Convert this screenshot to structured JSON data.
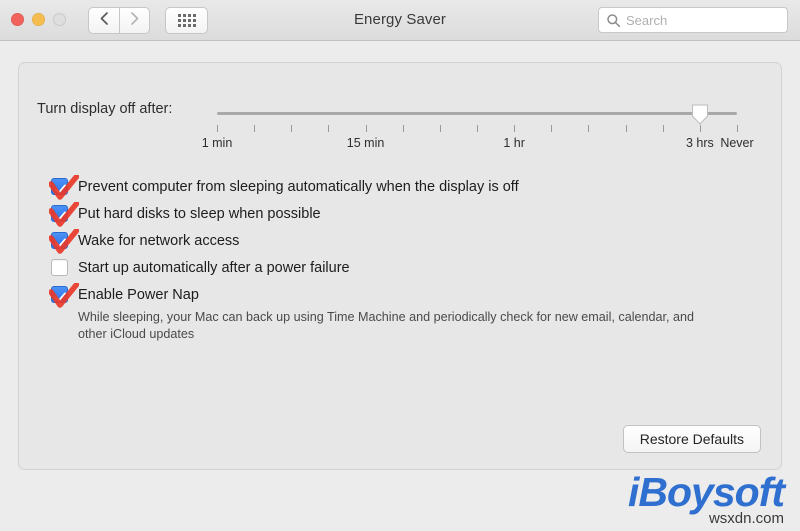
{
  "window": {
    "title": "Energy Saver",
    "traffic_lights": [
      "close",
      "minimize",
      "zoom"
    ]
  },
  "toolbar": {
    "back_icon": "chevron-left-icon",
    "forward_icon": "chevron-right-icon",
    "grid_icon": "show-all-grid-icon",
    "search": {
      "icon": "search-icon",
      "placeholder": "Search",
      "value": ""
    }
  },
  "slider": {
    "label": "Turn display off after:",
    "value_label": "3 hrs",
    "tick_count": 15,
    "thumb_tick_index": 13,
    "tick_labels": [
      {
        "index": 0,
        "text": "1 min"
      },
      {
        "index": 4,
        "text": "15 min"
      },
      {
        "index": 8,
        "text": "1 hr"
      },
      {
        "index": 13,
        "text": "3 hrs"
      },
      {
        "index": 14,
        "text": "Never"
      }
    ]
  },
  "checkboxes": [
    {
      "label": "Prevent computer from sleeping automatically when the display is off",
      "checked": true,
      "annotated": true,
      "annotation": "red-check-annotation"
    },
    {
      "label": "Put hard disks to sleep when possible",
      "checked": true,
      "annotated": true,
      "annotation": "red-check-annotation"
    },
    {
      "label": "Wake for network access",
      "checked": true,
      "annotated": true,
      "annotation": "red-check-annotation"
    },
    {
      "label": "Start up automatically after a power failure",
      "checked": false,
      "annotated": false,
      "annotation": ""
    },
    {
      "label": "Enable Power Nap",
      "checked": true,
      "annotated": true,
      "annotation": "red-check-annotation"
    }
  ],
  "description": "While sleeping, your Mac can back up using Time Machine and periodically check for new email, calendar, and other iCloud updates",
  "restore_button": "Restore Defaults",
  "watermark": {
    "logo": "iBoysoft",
    "site": "wsxdn.com"
  },
  "colors": {
    "checkbox_blue": "#2b73e6",
    "annotation_red": "#e8392a",
    "watermark_blue": "#2f6fd0",
    "window_bg": "#ececec",
    "panel_bg": "#e7e7e7"
  }
}
